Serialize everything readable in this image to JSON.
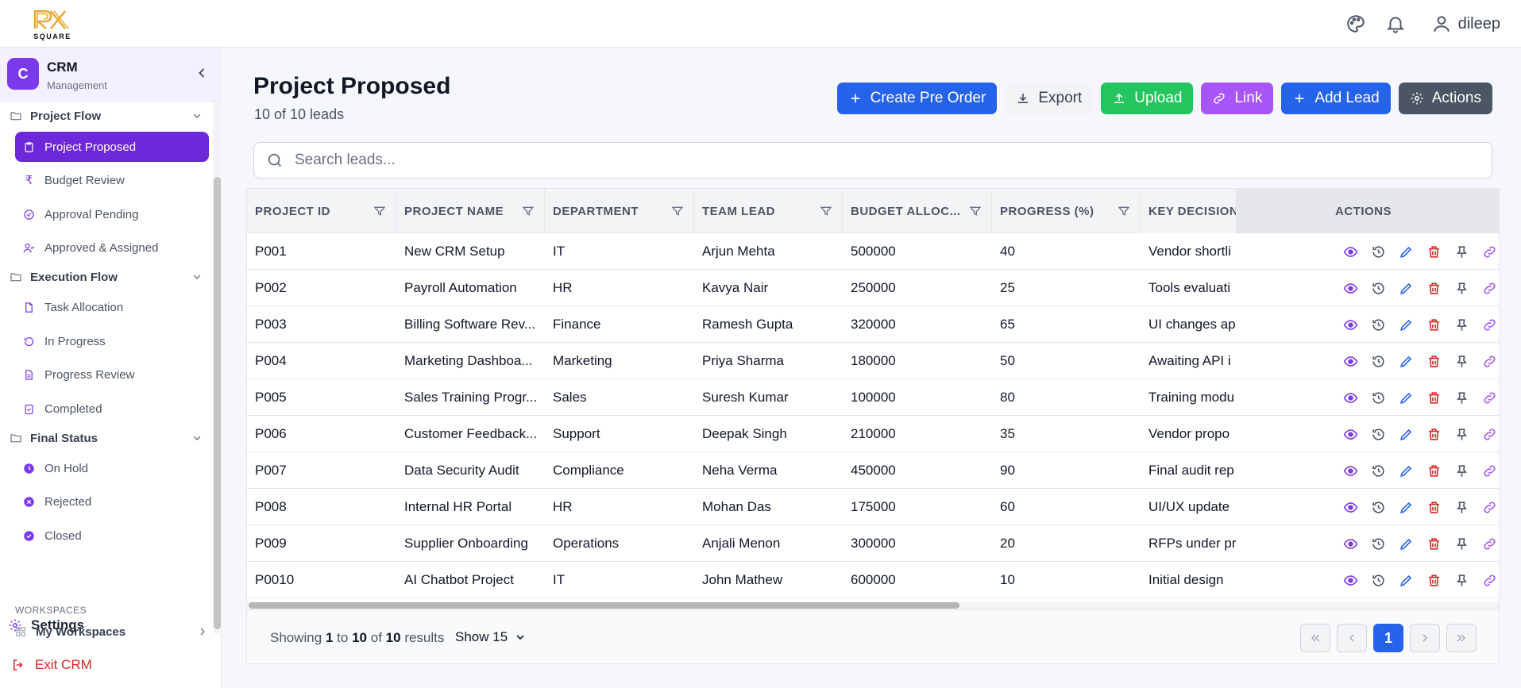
{
  "brand": {
    "logo_text": "SQUARE"
  },
  "user": {
    "name": "dileep"
  },
  "crm": {
    "badge": "C",
    "title": "CRM",
    "subtitle": "Management"
  },
  "sidebar": {
    "groups": [
      {
        "label": "Project Flow",
        "items": [
          "Project Proposed",
          "Budget Review",
          "Approval Pending",
          "Approved & Assigned"
        ]
      },
      {
        "label": "Execution Flow",
        "items": [
          "Task Allocation",
          "In Progress",
          "Progress Review",
          "Completed"
        ]
      },
      {
        "label": "Final Status",
        "items": [
          "On Hold",
          "Rejected",
          "Closed"
        ]
      }
    ],
    "active_item": "Project Proposed",
    "settings_label": "Settings",
    "workspaces_label": "WORKSPACES",
    "workspace_item": "My Workspaces",
    "exit_label": "Exit CRM"
  },
  "page": {
    "title": "Project Proposed",
    "subtitle": "10 of 10 leads"
  },
  "toolbar": {
    "create_pre_order": "Create Pre Order",
    "export": "Export",
    "upload": "Upload",
    "link": "Link",
    "add_lead": "Add Lead",
    "actions": "Actions"
  },
  "search": {
    "placeholder": "Search leads..."
  },
  "table": {
    "headers": [
      "PROJECT ID",
      "PROJECT NAME",
      "DEPARTMENT",
      "TEAM LEAD",
      "BUDGET ALLOC...",
      "PROGRESS (%)",
      "KEY DECISION",
      "ACTIONS"
    ],
    "rows": [
      [
        "P001",
        "New CRM Setup",
        "IT",
        "Arjun Mehta",
        "500000",
        "40",
        "Vendor shortli"
      ],
      [
        "P002",
        "Payroll Automation",
        "HR",
        "Kavya Nair",
        "250000",
        "25",
        "Tools evaluati"
      ],
      [
        "P003",
        "Billing Software Rev...",
        "Finance",
        "Ramesh Gupta",
        "320000",
        "65",
        "UI changes ap"
      ],
      [
        "P004",
        "Marketing Dashboa...",
        "Marketing",
        "Priya Sharma",
        "180000",
        "50",
        "Awaiting API i"
      ],
      [
        "P005",
        "Sales Training Progr...",
        "Sales",
        "Suresh Kumar",
        "100000",
        "80",
        "Training modu"
      ],
      [
        "P006",
        "Customer Feedback...",
        "Support",
        "Deepak Singh",
        "210000",
        "35",
        "Vendor propo"
      ],
      [
        "P007",
        "Data Security Audit",
        "Compliance",
        "Neha Verma",
        "450000",
        "90",
        "Final audit rep"
      ],
      [
        "P008",
        "Internal HR Portal",
        "HR",
        "Mohan Das",
        "175000",
        "60",
        "UI/UX update"
      ],
      [
        "P009",
        "Supplier Onboarding",
        "Operations",
        "Anjali Menon",
        "300000",
        "20",
        "RFPs under pr"
      ],
      [
        "P0010",
        "AI Chatbot Project",
        "IT",
        "John Mathew",
        "600000",
        "10",
        "Initial design"
      ]
    ]
  },
  "footer": {
    "showing_prefix": "Showing",
    "from": "1",
    "to_word": "to",
    "to": "10",
    "of_word": "of",
    "total": "10",
    "results_word": "results",
    "page_size": "Show 15",
    "current_page": "1"
  },
  "colors": {
    "primary_blue": "#2563eb",
    "sidebar_active": "#6d28d9",
    "green": "#22c55e",
    "purple": "#a855f7",
    "dark": "#4b5563",
    "danger": "#dc2626"
  }
}
